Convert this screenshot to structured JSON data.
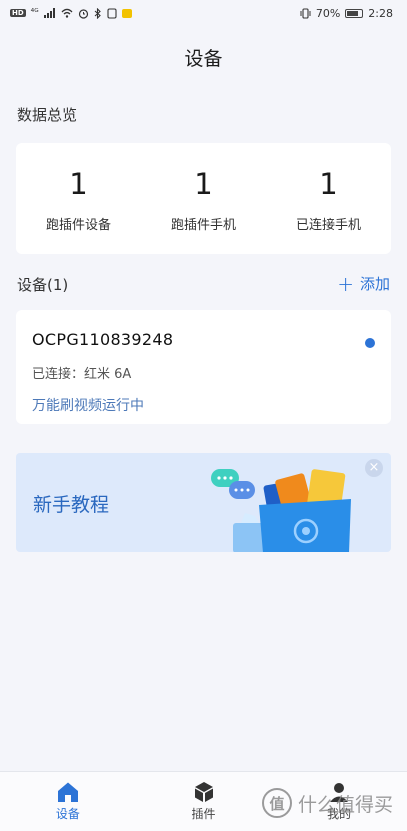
{
  "status_bar": {
    "hd": "HD",
    "signal": "⁴ᴳ",
    "battery_pct": "70%",
    "time": "2:28"
  },
  "page": {
    "title": "设备"
  },
  "overview": {
    "label": "数据总览",
    "items": [
      {
        "value": "1",
        "label": "跑插件设备"
      },
      {
        "value": "1",
        "label": "跑插件手机"
      },
      {
        "value": "1",
        "label": "已连接手机"
      }
    ]
  },
  "devices": {
    "label": "设备(1)",
    "add_label": "添加",
    "add_icon": "+",
    "item": {
      "id": "OCPG110839248",
      "connected": "已连接：红米 6A",
      "status": "万能刷视频运行中",
      "status_dot_color": "#2c73d6"
    }
  },
  "banner": {
    "text": "新手教程",
    "close_icon": "×"
  },
  "tabs": [
    {
      "label": "设备",
      "active": true
    },
    {
      "label": "插件",
      "active": false
    },
    {
      "label": "我的",
      "active": false
    }
  ],
  "watermark": {
    "logo": "值",
    "text": "什么值得买"
  },
  "colors": {
    "accent": "#2c73d6",
    "background": "#f4f5fa",
    "banner_bg": "#dde9fb"
  }
}
